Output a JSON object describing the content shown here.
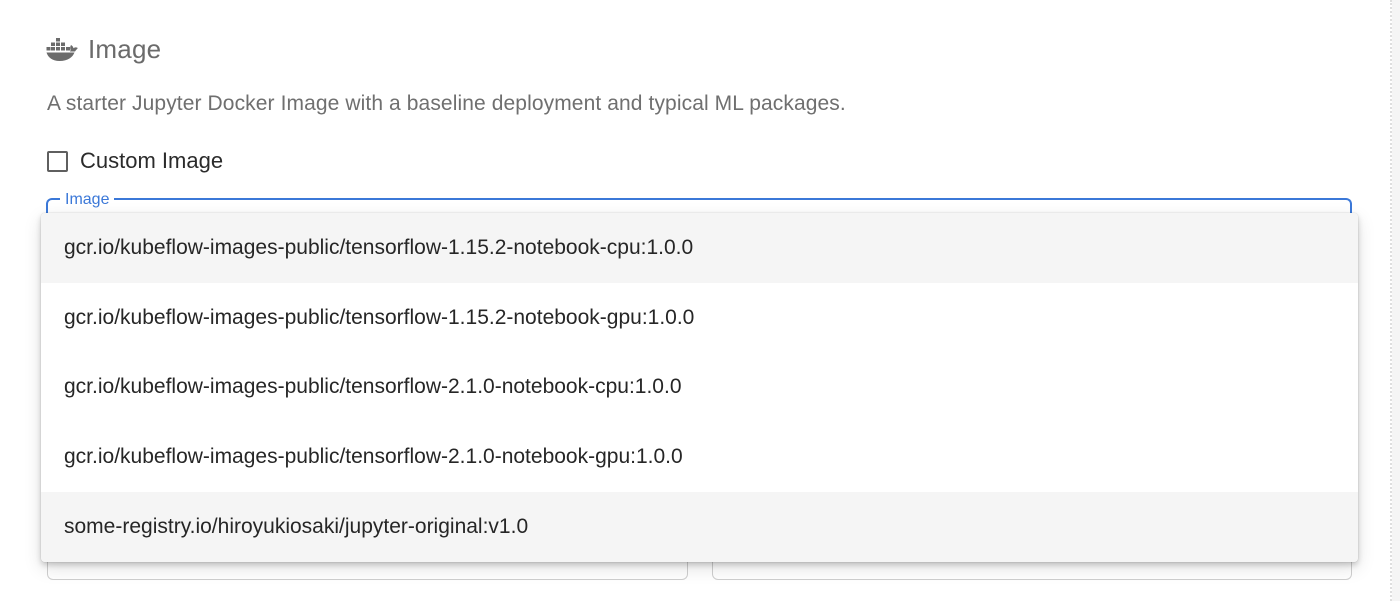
{
  "section": {
    "icon": "docker-whale-icon",
    "title": "Image",
    "description": "A starter Jupyter Docker Image with a baseline deployment and typical ML packages."
  },
  "custom_image": {
    "label": "Custom Image",
    "checked": false
  },
  "image_select": {
    "label": "Image",
    "accent_color": "#3b78d8",
    "options": [
      {
        "label": "gcr.io/kubeflow-images-public/tensorflow-1.15.2-notebook-cpu:1.0.0",
        "highlighted": true
      },
      {
        "label": "gcr.io/kubeflow-images-public/tensorflow-1.15.2-notebook-gpu:1.0.0",
        "highlighted": false
      },
      {
        "label": "gcr.io/kubeflow-images-public/tensorflow-2.1.0-notebook-cpu:1.0.0",
        "highlighted": false
      },
      {
        "label": "gcr.io/kubeflow-images-public/tensorflow-2.1.0-notebook-gpu:1.0.0",
        "highlighted": false
      },
      {
        "label": "some-registry.io/hiroyukiosaki/jupyter-original:v1.0",
        "highlighted": true
      }
    ]
  }
}
